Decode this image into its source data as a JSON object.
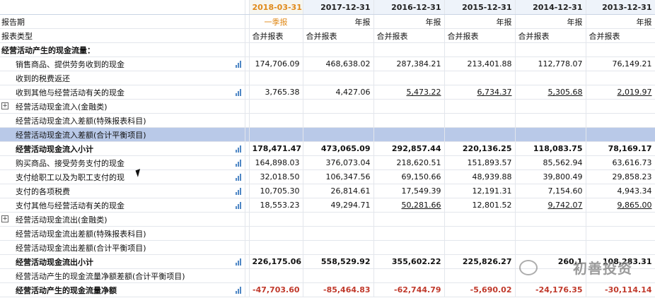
{
  "header": {
    "label": "",
    "dates": [
      "2018-03-31",
      "2017-12-31",
      "2016-12-31",
      "2015-12-31",
      "2014-12-31",
      "2013-12-31"
    ]
  },
  "report_period": {
    "label": "报告期",
    "values": [
      "一季报",
      "年报",
      "年报",
      "年报",
      "年报",
      "年报"
    ]
  },
  "report_type": {
    "label": "报表类型",
    "values": [
      "合并报表",
      "合并报表",
      "合并报表",
      "合并报表",
      "合并报表",
      "合并报表"
    ]
  },
  "section_title": "经营活动产生的现金流量：",
  "rows": [
    {
      "label": "销售商品、提供劳务收到的现金",
      "values": [
        "174,706.09",
        "468,638.02",
        "287,384.21",
        "213,401.88",
        "112,778.07",
        "76,149.21"
      ]
    },
    {
      "label": "收到的税费返还",
      "values": [
        "",
        "",
        "",
        "",
        "",
        ""
      ]
    },
    {
      "label": "收到其他与经营活动有关的现金",
      "values": [
        "3,765.38",
        "4,427.06",
        "5,473.22",
        "6,734.37",
        "5,305.68",
        "2,019.97"
      ]
    },
    {
      "label": "经营活动现金流入(金融类)",
      "values": [
        "",
        "",
        "",
        "",
        "",
        ""
      ]
    },
    {
      "label": "经营活动现金流入差额(特殊报表科目)",
      "values": [
        "",
        "",
        "",
        "",
        "",
        ""
      ]
    },
    {
      "label": "经营活动现金流入差额(合计平衡项目)",
      "values": [
        "",
        "",
        "",
        "",
        "",
        ""
      ]
    },
    {
      "label": "经营活动现金流入小计",
      "values": [
        "178,471.47",
        "473,065.09",
        "292,857.44",
        "220,136.25",
        "118,083.75",
        "78,169.17"
      ]
    },
    {
      "label": "购买商品、接受劳务支付的现金",
      "values": [
        "164,898.03",
        "376,073.04",
        "218,620.51",
        "151,893.57",
        "85,562.94",
        "63,616.73"
      ]
    },
    {
      "label": "支付给职工以及为职工支付的现",
      "values": [
        "32,018.50",
        "106,347.56",
        "69,150.66",
        "48,939.88",
        "39,800.49",
        "29,858.23"
      ]
    },
    {
      "label": "支付的各项税费",
      "values": [
        "10,705.30",
        "26,814.61",
        "17,549.39",
        "12,191.31",
        "7,154.60",
        "4,943.34"
      ]
    },
    {
      "label": "支付其他与经营活动有关的现金",
      "values": [
        "18,553.23",
        "49,294.71",
        "50,281.66",
        "12,801.52",
        "9,742.07",
        "9,865.00"
      ]
    },
    {
      "label": "经营活动现金流出(金融类)",
      "values": [
        "",
        "",
        "",
        "",
        "",
        ""
      ]
    },
    {
      "label": "经营活动现金流出差额(特殊报表科目)",
      "values": [
        "",
        "",
        "",
        "",
        "",
        ""
      ]
    },
    {
      "label": "经营活动现金流出差额(合计平衡项目)",
      "values": [
        "",
        "",
        "",
        "",
        "",
        ""
      ]
    },
    {
      "label": "经营活动现金流出小计",
      "values": [
        "226,175.06",
        "558,529.92",
        "355,602.22",
        "225,826.27",
        "260.1",
        "108,283.31"
      ]
    },
    {
      "label": "经营活动产生的现金流量净额差额(合计平衡项目)",
      "values": [
        "",
        "",
        "",
        "",
        "",
        ""
      ]
    },
    {
      "label": "经营活动产生的现金流量净额",
      "values": [
        "-47,703.60",
        "-85,464.83",
        "-62,744.79",
        "-5,690.02",
        "-24,176.35",
        "-30,114.14"
      ]
    }
  ],
  "watermark": {
    "text": "初善投资",
    "left_mark": ""
  },
  "colors": {
    "active_date": "#e08a1a",
    "highlight_row": "#b9c9e8",
    "chart_icon": "#4f87c5"
  }
}
